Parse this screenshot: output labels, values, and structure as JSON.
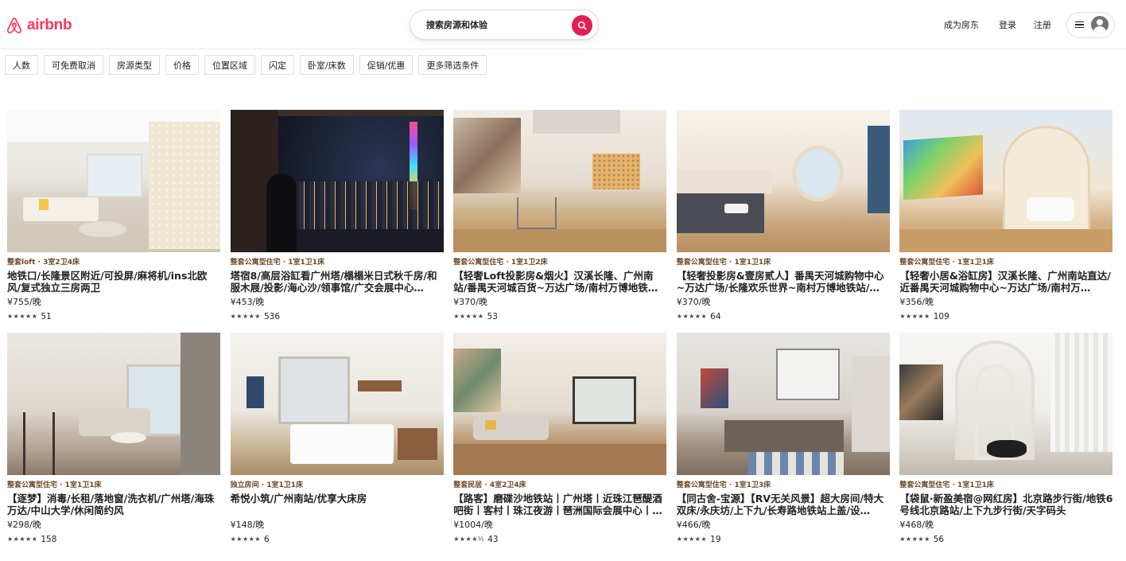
{
  "brand": {
    "name": "airbnb",
    "color": "#ff385c"
  },
  "search": {
    "placeholder": "搜索房源和体验",
    "button_icon": "search-icon",
    "button_color": "#e51d53"
  },
  "nav": {
    "host": "成为房东",
    "login": "登录",
    "signup": "注册",
    "menu_icon": "hamburger-icon",
    "avatar_icon": "user-avatar-icon"
  },
  "filters": [
    "人数",
    "可免费取消",
    "房源类型",
    "价格",
    "位置区域",
    "闪定",
    "卧室/床数",
    "促销/优惠",
    "更多筛选条件"
  ],
  "listings": [
    {
      "meta": "整套loft · 3室2卫4床",
      "title": "地铁口/长隆景区附近/可投屏/麻将机/ins北欧风/复式独立三房两卫",
      "price": "¥755/晚",
      "stars": "★★★★★",
      "reviews": "51"
    },
    {
      "meta": "整套公寓型住宅 · 1室1卫1床",
      "title": "塔宿8/高层浴缸看广州塔/榻榻米日式秋千房/和服木屐/投影/海心沙/领事馆/广交会展中心…",
      "price": "¥453/晚",
      "stars": "★★★★★",
      "reviews": "536"
    },
    {
      "meta": "整套公寓型住宅 · 1室1卫2床",
      "title": "【轻奢Loft投影房&烟火】汉溪长隆、广州南站/番禺天河城百货~万达广场/南村万博地铁…",
      "price": "¥370/晚",
      "stars": "★★★★★",
      "reviews": "53"
    },
    {
      "meta": "整套公寓型住宅 · 1室1卫1床",
      "title": "【轻奢投影房&壹房贰人】番禺天河城购物中心~万达广场/长隆欢乐世界~南村万博地铁站/…",
      "price": "¥370/晚",
      "stars": "★★★★★",
      "reviews": "64"
    },
    {
      "meta": "整套公寓型住宅 · 1室1卫1床",
      "title": "【轻奢小居&浴缸房】汉溪长隆、广州南站直达/近番禺天河城购物中心~万达广场/南村万…",
      "price": "¥356/晚",
      "stars": "★★★★★",
      "reviews": "109"
    },
    {
      "meta": "整套公寓型住宅 · 1室1卫1床",
      "title": "【逐梦】消毒/长租/落地窗/洗衣机/广州塔/海珠万达/中山大学/休闲简约风",
      "price": "¥298/晚",
      "stars": "★★★★★",
      "reviews": "158"
    },
    {
      "meta": "独立房间 · 1室1卫1床",
      "title": "希悦小筑/广州南站/优享大床房",
      "price": "¥148/晚",
      "stars": "★★★★★",
      "reviews": "6"
    },
    {
      "meta": "整套民居 · 4室2卫4床",
      "title": "【路客】磨碟沙地铁站丨广州塔丨近珠江琶醍酒吧街丨客村丨珠江夜游丨琶洲国际会展中心丨…",
      "price": "¥1004/晚",
      "stars": "★★★★½",
      "reviews": "43"
    },
    {
      "meta": "整套公寓型住宅 · 1室1卫3床",
      "title": "【同古舍-宝源】【RV无关风景】超大房间/特大双床/永庆坊/上下九/长寿路地铁站上盖/设…",
      "price": "¥466/晚",
      "stars": "★★★★★",
      "reviews": "19"
    },
    {
      "meta": "整套公寓型住宅 · 1室1卫1床",
      "title": "【袋鼠·新盈美宿@网红房】北京路步行街/地铁6号线北京路站/上下九步行街/天字码头",
      "price": "¥468/晚",
      "stars": "★★★★★",
      "reviews": "56"
    }
  ]
}
